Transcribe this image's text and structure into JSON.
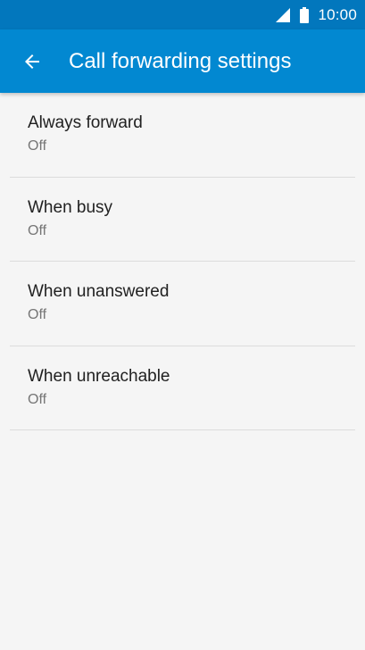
{
  "status_bar": {
    "time": "10:00",
    "icons": [
      "signal-icon",
      "battery-icon"
    ]
  },
  "app_bar": {
    "back_icon": "arrow-back-icon",
    "title": "Call forwarding settings"
  },
  "items": [
    {
      "title": "Always forward",
      "summary": "Off"
    },
    {
      "title": "When busy",
      "summary": "Off"
    },
    {
      "title": "When unanswered",
      "summary": "Off"
    },
    {
      "title": "When unreachable",
      "summary": "Off"
    }
  ],
  "colors": {
    "status_bar": "#0277bd",
    "app_bar": "#0288d1",
    "background": "#f5f5f5",
    "divider": "#dcdcdc"
  }
}
